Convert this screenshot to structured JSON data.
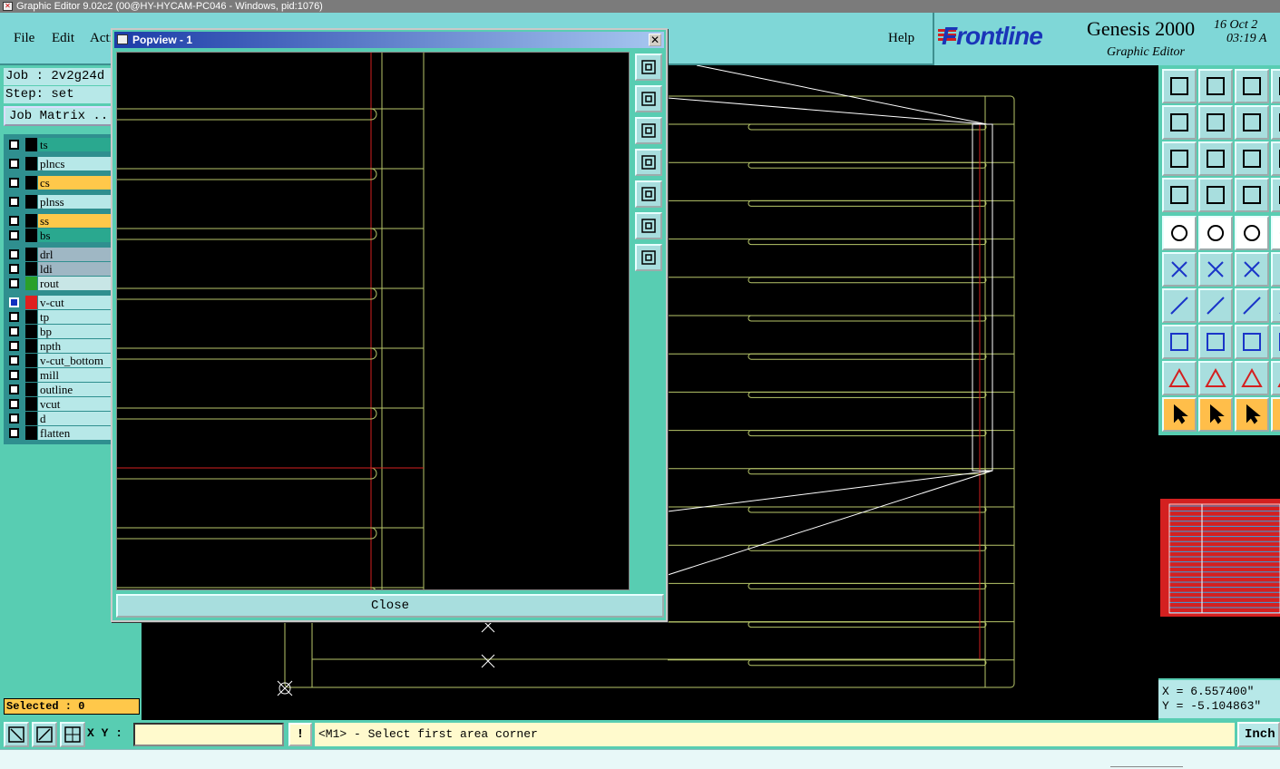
{
  "window": {
    "title": "Graphic Editor 9.02c2 (00@HY-HYCAM-PC046 - Windows, pid:1076)"
  },
  "menu": {
    "items": [
      "File",
      "Edit",
      "Acti"
    ],
    "help": "Help"
  },
  "brand": {
    "logo": "Frontline",
    "product": "Genesis 2000",
    "subtitle": "Graphic Editor",
    "date_line1": "16 Oct 2",
    "date_line2": "03:19 A"
  },
  "job": {
    "job_label": "Job : 2v2g24d",
    "step_label": "Step: set",
    "matrix_button": "Job Matrix .."
  },
  "layers": [
    {
      "name": "ts",
      "bg": "#2aa88f",
      "sw": "#000000"
    },
    {
      "name": "plncs",
      "bg": "#b7e8e8",
      "sw": "#000000"
    },
    {
      "name": "cs",
      "bg": "#ffc84a",
      "sw": "#000000"
    },
    {
      "name": "plnss",
      "bg": "#b7e8e8",
      "sw": "#000000"
    },
    {
      "name": "ss",
      "bg": "#ffc84a",
      "sw": "#000000"
    },
    {
      "name": "bs",
      "bg": "#2aa88f",
      "sw": "#000000"
    },
    {
      "name": "drl",
      "bg": "#9fb7c4",
      "sw": "#000000"
    },
    {
      "name": "ldi",
      "bg": "#9fb7c4",
      "sw": "#000000"
    },
    {
      "name": "rout",
      "bg": "#c8e6e6",
      "sw": "#2aa02a"
    },
    {
      "name": "v-cut",
      "bg": "#b7e8e8",
      "sw": "#e02020",
      "active": true
    },
    {
      "name": "tp",
      "bg": "#b7e8e8",
      "sw": "#000000"
    },
    {
      "name": "bp",
      "bg": "#b7e8e8",
      "sw": "#000000"
    },
    {
      "name": "npth",
      "bg": "#b7e8e8",
      "sw": "#000000"
    },
    {
      "name": "v-cut_bottom",
      "bg": "#b7e8e8",
      "sw": "#000000"
    },
    {
      "name": "mill",
      "bg": "#b7e8e8",
      "sw": "#000000"
    },
    {
      "name": "outline",
      "bg": "#b7e8e8",
      "sw": "#000000"
    },
    {
      "name": "vcut",
      "bg": "#b7e8e8",
      "sw": "#000000"
    },
    {
      "name": "d",
      "bg": "#b7e8e8",
      "sw": "#000000"
    },
    {
      "name": "flatten",
      "bg": "#b7e8e8",
      "sw": "#000000"
    }
  ],
  "selection": {
    "label": "Selected : 0"
  },
  "popview": {
    "title": "Popview - 1",
    "close_label": "Close",
    "close_x": "✕"
  },
  "coordinates": {
    "x": "X = 6.557400\"",
    "y": "Y = -5.104863\""
  },
  "status": {
    "xy_label": "X Y :",
    "xy_value": "",
    "warn": "!",
    "message": "<M1> - Select first area corner",
    "units": "Inch"
  },
  "colors": {
    "board_outline": "#b7c66a",
    "vcut_line": "#d42020",
    "selection_line": "#ffffff",
    "panel_bg": "#58cdb2"
  }
}
